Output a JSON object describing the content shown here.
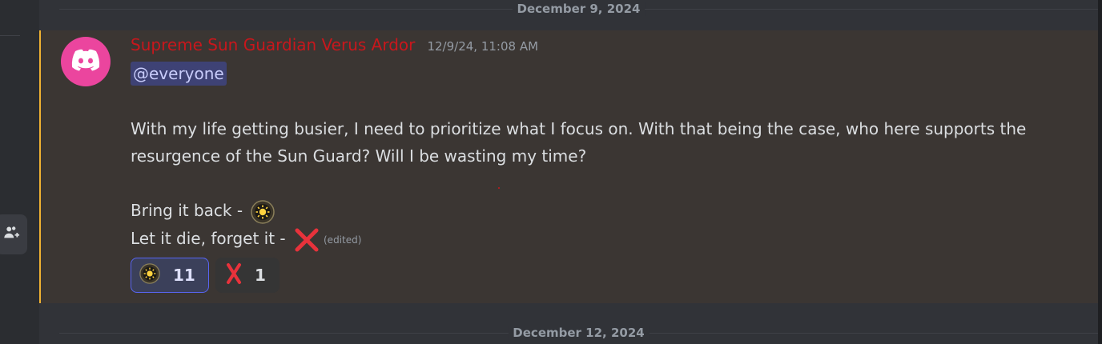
{
  "dividers": {
    "top_date": "December 9, 2024",
    "bottom_date": "December 12, 2024"
  },
  "message": {
    "author": "Supreme Sun Guardian Verus Ardor",
    "author_color": "#c8171c",
    "timestamp": "12/9/24, 11:08 AM",
    "mention": "@everyone",
    "body_line_1": "With my life getting busier, I need to prioritize what I focus on. With that being the case, who here supports the",
    "body_line_2": "resurgence of the Sun Guard? Will I be wasting my time?",
    "option_1_text": "Bring it back - ",
    "option_1_emoji": "sun-emblem-emoji",
    "option_2_text": "Let it die, forget it - ",
    "option_2_emoji": "red-x-emoji",
    "edited_label": "(edited)",
    "highlight_color": "#f0b232"
  },
  "reactions": [
    {
      "emoji": "sun-emblem-emoji",
      "count": "11",
      "active": true
    },
    {
      "emoji": "red-x-emoji",
      "count": "1",
      "active": false
    }
  ],
  "sidebar": {
    "invite_icon": "add-member-icon"
  }
}
